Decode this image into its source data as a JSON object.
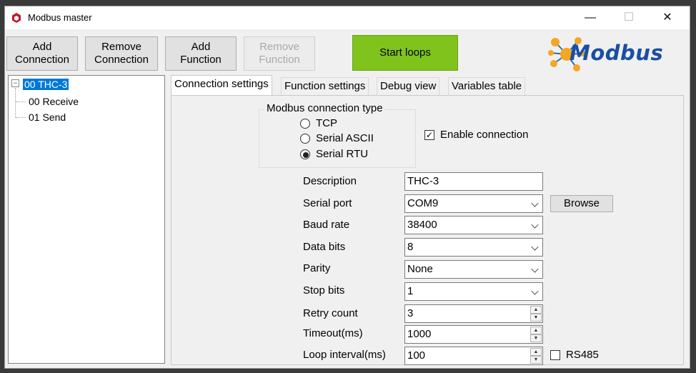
{
  "window": {
    "title": "Modbus master",
    "minimize": "—",
    "maximize": "☐",
    "close": "✕"
  },
  "toolbar": {
    "add_connection": [
      "Add",
      "Connection"
    ],
    "remove_connection": [
      "Remove",
      "Connection"
    ],
    "add_function": [
      "Add",
      "Function"
    ],
    "remove_function": [
      "Remove",
      "Function"
    ],
    "start_loops": "Start loops",
    "logo_text": "Modbus"
  },
  "tree": {
    "root": "00 THC-3",
    "root_toggle": "⊟",
    "children": [
      "00 Receive",
      "01 Send"
    ]
  },
  "tabs": [
    "Connection settings",
    "Function settings",
    "Debug view",
    "Variables table"
  ],
  "connection_type": {
    "legend": "Modbus connection type",
    "options": [
      "TCP",
      "Serial ASCII",
      "Serial RTU"
    ],
    "selected": "Serial RTU"
  },
  "enable_connection": {
    "label": "Enable connection",
    "checked": true,
    "mark": "✓"
  },
  "fields": {
    "description": {
      "label": "Description",
      "value": "THC-3"
    },
    "serial_port": {
      "label": "Serial port",
      "value": "COM9",
      "browse": "Browse"
    },
    "baud_rate": {
      "label": "Baud rate",
      "value": "38400"
    },
    "data_bits": {
      "label": "Data bits",
      "value": "8"
    },
    "parity": {
      "label": "Parity",
      "value": "None"
    },
    "stop_bits": {
      "label": "Stop bits",
      "value": "1"
    },
    "retry_count": {
      "label": "Retry count",
      "value": "3"
    },
    "timeout": {
      "label": "Timeout(ms)",
      "value": "1000"
    },
    "loop_interval": {
      "label": "Loop interval(ms)",
      "value": "100"
    }
  },
  "rs485": {
    "label": "RS485",
    "checked": false
  },
  "colors": {
    "start_button": "#7fc31c",
    "tree_selection": "#0078d7",
    "logo_blue": "#1a4fa3",
    "logo_orange": "#f5a623"
  }
}
